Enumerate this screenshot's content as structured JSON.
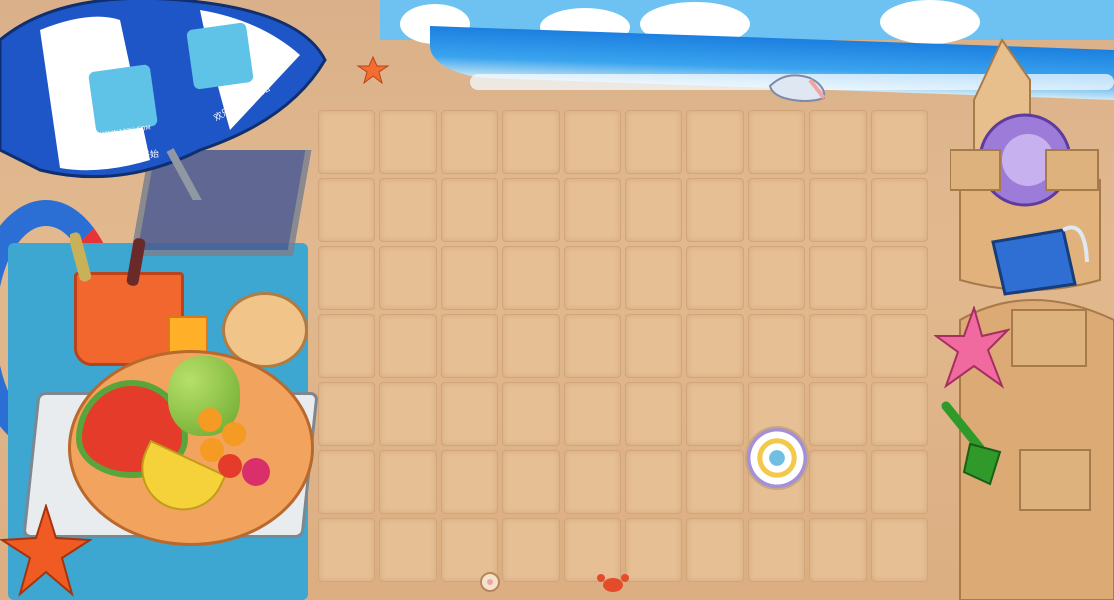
{
  "scene": {
    "board": {
      "rows": 7,
      "columns": 10
    },
    "umbrella": {
      "logo_text": "欢乐从这里开始",
      "url_text": "WWW.123U.COM"
    },
    "colors": {
      "sand": "#e2b98f",
      "tile": "#e6bf95",
      "sea": "#1c7fe0",
      "sky": "#6ec2f2",
      "umbrella_blue": "#1f56c7"
    },
    "icons": [
      "beach-umbrella",
      "fruit-plate",
      "ice-bucket",
      "coconut-drink",
      "starfish",
      "sand-castle",
      "sea-shell",
      "sand-bucket",
      "shovel",
      "crab",
      "swim-ring"
    ]
  }
}
